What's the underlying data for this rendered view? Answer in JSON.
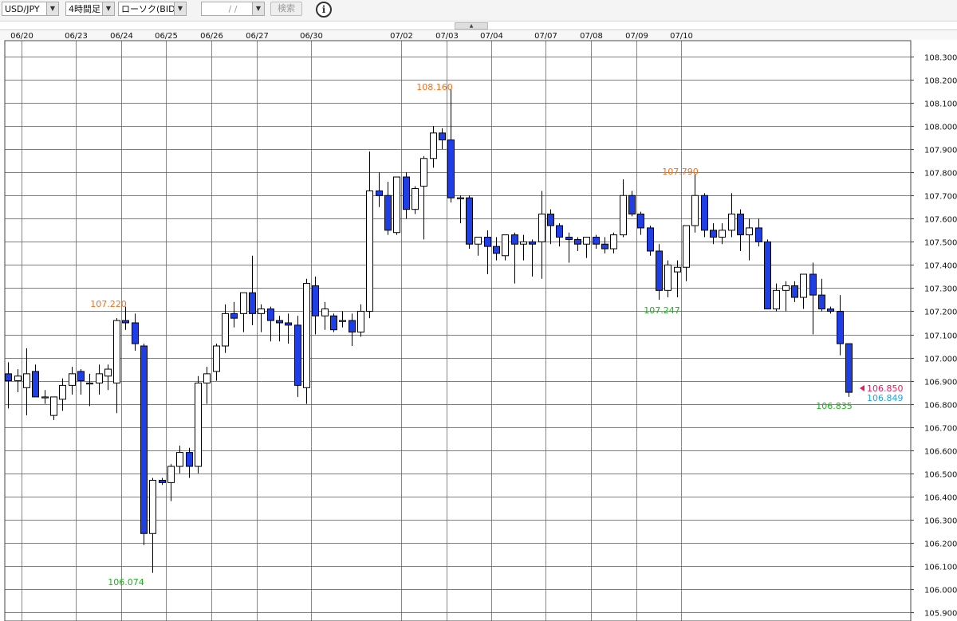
{
  "toolbar": {
    "pair": "USD/JPY",
    "timeframe": "4時間足",
    "chart_type": "ローソク(BID)",
    "date_input": " /  / ",
    "search_label": "検索",
    "info_label": "i"
  },
  "colors": {
    "bear_fill": "#1f3fe6",
    "bull_fill": "#ffffff",
    "candle_edge": "#000000",
    "high_annotation": "#ff6a13",
    "low_annotation": "#19b519",
    "ask_price": "#e8185a",
    "bid_price": "#18a8e8",
    "grid": "#555555"
  },
  "chart_data": {
    "type": "candlestick",
    "x_labels": [
      "06/20",
      "06/23",
      "06/24",
      "06/25",
      "06/26",
      "06/27",
      "06/30",
      "07/02",
      "07/03",
      "07/04",
      "07/07",
      "07/08",
      "07/09",
      "07/10"
    ],
    "x_label_positions": [
      1.5,
      7.5,
      12.5,
      17.5,
      22.5,
      27.5,
      33.5,
      43.5,
      48.5,
      53.5,
      59.5,
      64.5,
      69.5,
      74.5
    ],
    "ylim": [
      105.9,
      108.3
    ],
    "y_ticks": [
      "108.300",
      "108.200",
      "108.100",
      "108.000",
      "107.900",
      "107.800",
      "107.700",
      "107.600",
      "107.500",
      "107.400",
      "107.300",
      "107.200",
      "107.100",
      "107.000",
      "106.900",
      "106.800",
      "106.700",
      "106.600",
      "106.500",
      "106.400",
      "106.300",
      "106.200",
      "106.100",
      "106.000",
      "105.900"
    ],
    "candles": [
      {
        "o": 106.93,
        "h": 106.98,
        "l": 106.78,
        "c": 106.9
      },
      {
        "o": 106.9,
        "h": 106.95,
        "l": 106.85,
        "c": 106.92
      },
      {
        "o": 106.87,
        "h": 107.04,
        "l": 106.75,
        "c": 106.93
      },
      {
        "o": 106.94,
        "h": 106.97,
        "l": 106.84,
        "c": 106.83
      },
      {
        "o": 106.83,
        "h": 106.86,
        "l": 106.8,
        "c": 106.83
      },
      {
        "o": 106.75,
        "h": 106.83,
        "l": 106.73,
        "c": 106.83
      },
      {
        "o": 106.82,
        "h": 106.91,
        "l": 106.77,
        "c": 106.88
      },
      {
        "o": 106.88,
        "h": 106.96,
        "l": 106.84,
        "c": 106.93
      },
      {
        "o": 106.94,
        "h": 106.95,
        "l": 106.84,
        "c": 106.9
      },
      {
        "o": 106.89,
        "h": 106.93,
        "l": 106.79,
        "c": 106.89
      },
      {
        "o": 106.89,
        "h": 106.97,
        "l": 106.84,
        "c": 106.93
      },
      {
        "o": 106.92,
        "h": 106.97,
        "l": 106.86,
        "c": 106.95
      },
      {
        "o": 106.89,
        "h": 107.17,
        "l": 106.76,
        "c": 107.16
      },
      {
        "o": 107.16,
        "h": 107.22,
        "l": 107.12,
        "c": 107.15
      },
      {
        "o": 107.15,
        "h": 107.19,
        "l": 107.03,
        "c": 107.06
      },
      {
        "o": 107.05,
        "h": 107.06,
        "l": 106.19,
        "c": 106.24
      },
      {
        "o": 106.24,
        "h": 106.48,
        "l": 106.07,
        "c": 106.47
      },
      {
        "o": 106.47,
        "h": 106.48,
        "l": 106.45,
        "c": 106.46
      },
      {
        "o": 106.46,
        "h": 106.54,
        "l": 106.38,
        "c": 106.53
      },
      {
        "o": 106.53,
        "h": 106.62,
        "l": 106.5,
        "c": 106.59
      },
      {
        "o": 106.59,
        "h": 106.61,
        "l": 106.48,
        "c": 106.53
      },
      {
        "o": 106.53,
        "h": 106.92,
        "l": 106.5,
        "c": 106.89
      },
      {
        "o": 106.89,
        "h": 106.96,
        "l": 106.8,
        "c": 106.93
      },
      {
        "o": 106.94,
        "h": 107.06,
        "l": 106.9,
        "c": 107.05
      },
      {
        "o": 107.05,
        "h": 107.23,
        "l": 107.02,
        "c": 107.19
      },
      {
        "o": 107.19,
        "h": 107.24,
        "l": 107.13,
        "c": 107.17
      },
      {
        "o": 107.19,
        "h": 107.28,
        "l": 107.11,
        "c": 107.28
      },
      {
        "o": 107.28,
        "h": 107.44,
        "l": 107.14,
        "c": 107.19
      },
      {
        "o": 107.19,
        "h": 107.23,
        "l": 107.11,
        "c": 107.21
      },
      {
        "o": 107.21,
        "h": 107.22,
        "l": 107.07,
        "c": 107.16
      },
      {
        "o": 107.16,
        "h": 107.18,
        "l": 107.07,
        "c": 107.15
      },
      {
        "o": 107.15,
        "h": 107.19,
        "l": 107.06,
        "c": 107.14
      },
      {
        "o": 107.14,
        "h": 107.18,
        "l": 106.83,
        "c": 106.88
      },
      {
        "o": 106.87,
        "h": 107.34,
        "l": 106.8,
        "c": 107.32
      },
      {
        "o": 107.31,
        "h": 107.35,
        "l": 107.1,
        "c": 107.18
      },
      {
        "o": 107.18,
        "h": 107.24,
        "l": 107.12,
        "c": 107.21
      },
      {
        "o": 107.18,
        "h": 107.19,
        "l": 107.11,
        "c": 107.12
      },
      {
        "o": 107.16,
        "h": 107.2,
        "l": 107.13,
        "c": 107.16
      },
      {
        "o": 107.16,
        "h": 107.19,
        "l": 107.05,
        "c": 107.11
      },
      {
        "o": 107.11,
        "h": 107.23,
        "l": 107.09,
        "c": 107.2
      },
      {
        "o": 107.2,
        "h": 107.89,
        "l": 107.17,
        "c": 107.72
      },
      {
        "o": 107.72,
        "h": 107.8,
        "l": 107.65,
        "c": 107.7
      },
      {
        "o": 107.7,
        "h": 107.76,
        "l": 107.53,
        "c": 107.55
      },
      {
        "o": 107.54,
        "h": 107.78,
        "l": 107.53,
        "c": 107.78
      },
      {
        "o": 107.78,
        "h": 107.8,
        "l": 107.6,
        "c": 107.64
      },
      {
        "o": 107.64,
        "h": 107.74,
        "l": 107.62,
        "c": 107.73
      },
      {
        "o": 107.74,
        "h": 107.87,
        "l": 107.51,
        "c": 107.86
      },
      {
        "o": 107.86,
        "h": 108.0,
        "l": 107.82,
        "c": 107.97
      },
      {
        "o": 107.97,
        "h": 107.99,
        "l": 107.9,
        "c": 107.94
      },
      {
        "o": 107.94,
        "h": 108.16,
        "l": 107.67,
        "c": 107.69
      },
      {
        "o": 107.69,
        "h": 107.7,
        "l": 107.58,
        "c": 107.69
      },
      {
        "o": 107.69,
        "h": 107.7,
        "l": 107.47,
        "c": 107.49
      },
      {
        "o": 107.49,
        "h": 107.52,
        "l": 107.44,
        "c": 107.52
      },
      {
        "o": 107.52,
        "h": 107.55,
        "l": 107.36,
        "c": 107.48
      },
      {
        "o": 107.48,
        "h": 107.52,
        "l": 107.42,
        "c": 107.45
      },
      {
        "o": 107.44,
        "h": 107.53,
        "l": 107.42,
        "c": 107.53
      },
      {
        "o": 107.53,
        "h": 107.54,
        "l": 107.32,
        "c": 107.49
      },
      {
        "o": 107.49,
        "h": 107.53,
        "l": 107.42,
        "c": 107.5
      },
      {
        "o": 107.5,
        "h": 107.51,
        "l": 107.35,
        "c": 107.49
      },
      {
        "o": 107.5,
        "h": 107.72,
        "l": 107.34,
        "c": 107.62
      },
      {
        "o": 107.62,
        "h": 107.64,
        "l": 107.49,
        "c": 107.57
      },
      {
        "o": 107.57,
        "h": 107.58,
        "l": 107.48,
        "c": 107.52
      },
      {
        "o": 107.52,
        "h": 107.54,
        "l": 107.41,
        "c": 107.51
      },
      {
        "o": 107.51,
        "h": 107.52,
        "l": 107.46,
        "c": 107.49
      },
      {
        "o": 107.49,
        "h": 107.5,
        "l": 107.43,
        "c": 107.52
      },
      {
        "o": 107.52,
        "h": 107.53,
        "l": 107.47,
        "c": 107.49
      },
      {
        "o": 107.49,
        "h": 107.52,
        "l": 107.45,
        "c": 107.47
      },
      {
        "o": 107.47,
        "h": 107.54,
        "l": 107.45,
        "c": 107.53
      },
      {
        "o": 107.53,
        "h": 107.77,
        "l": 107.52,
        "c": 107.7
      },
      {
        "o": 107.7,
        "h": 107.72,
        "l": 107.61,
        "c": 107.62
      },
      {
        "o": 107.62,
        "h": 107.63,
        "l": 107.53,
        "c": 107.56
      },
      {
        "o": 107.56,
        "h": 107.57,
        "l": 107.44,
        "c": 107.46
      },
      {
        "o": 107.46,
        "h": 107.49,
        "l": 107.25,
        "c": 107.29
      },
      {
        "o": 107.29,
        "h": 107.42,
        "l": 107.26,
        "c": 107.4
      },
      {
        "o": 107.37,
        "h": 107.42,
        "l": 107.26,
        "c": 107.39
      },
      {
        "o": 107.39,
        "h": 107.57,
        "l": 107.33,
        "c": 107.57
      },
      {
        "o": 107.57,
        "h": 107.79,
        "l": 107.54,
        "c": 107.7
      },
      {
        "o": 107.7,
        "h": 107.71,
        "l": 107.52,
        "c": 107.55
      },
      {
        "o": 107.55,
        "h": 107.58,
        "l": 107.49,
        "c": 107.52
      },
      {
        "o": 107.52,
        "h": 107.58,
        "l": 107.49,
        "c": 107.55
      },
      {
        "o": 107.55,
        "h": 107.71,
        "l": 107.52,
        "c": 107.62
      },
      {
        "o": 107.62,
        "h": 107.64,
        "l": 107.46,
        "c": 107.53
      },
      {
        "o": 107.53,
        "h": 107.6,
        "l": 107.42,
        "c": 107.56
      },
      {
        "o": 107.56,
        "h": 107.6,
        "l": 107.48,
        "c": 107.5
      },
      {
        "o": 107.5,
        "h": 107.51,
        "l": 107.21,
        "c": 107.21
      },
      {
        "o": 107.21,
        "h": 107.32,
        "l": 107.2,
        "c": 107.29
      },
      {
        "o": 107.29,
        "h": 107.33,
        "l": 107.2,
        "c": 107.31
      },
      {
        "o": 107.31,
        "h": 107.33,
        "l": 107.24,
        "c": 107.26
      },
      {
        "o": 107.26,
        "h": 107.36,
        "l": 107.21,
        "c": 107.36
      },
      {
        "o": 107.36,
        "h": 107.41,
        "l": 107.1,
        "c": 107.27
      },
      {
        "o": 107.27,
        "h": 107.34,
        "l": 107.2,
        "c": 107.21
      },
      {
        "o": 107.21,
        "h": 107.22,
        "l": 107.19,
        "c": 107.2
      },
      {
        "o": 107.2,
        "h": 107.27,
        "l": 107.01,
        "c": 107.06
      },
      {
        "o": 107.06,
        "h": 107.06,
        "l": 106.83,
        "c": 106.85
      }
    ],
    "annotations": {
      "high_1": {
        "text": "107.220",
        "value": 107.22,
        "kind": "high"
      },
      "low_1": {
        "text": "106.074",
        "value": 106.074,
        "kind": "low"
      },
      "high_2": {
        "text": "108.160",
        "value": 108.16,
        "kind": "high"
      },
      "high_3": {
        "text": "107.790",
        "value": 107.79,
        "kind": "high"
      },
      "low_2": {
        "text": "107.247",
        "value": 107.247,
        "kind": "low"
      },
      "low_3": {
        "text": "106.835",
        "value": 106.835,
        "kind": "low"
      }
    },
    "current_prices": {
      "ask": {
        "text": "106.850",
        "value": 106.85
      },
      "bid": {
        "text": "106.849",
        "value": 106.849
      }
    }
  }
}
